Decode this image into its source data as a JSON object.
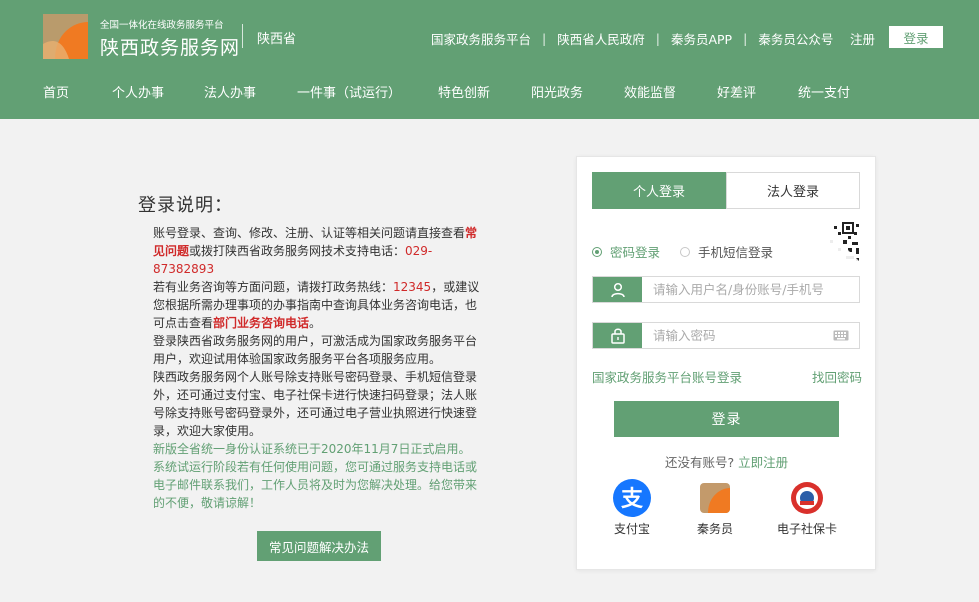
{
  "header": {
    "platform_tagline": "全国一体化在线政务服务平台",
    "site_name": "陕西政务服务网",
    "region": "陕西省",
    "links": [
      "国家政务服务平台",
      "陕西省人民政府",
      "秦务员APP",
      "秦务员公众号"
    ],
    "link_separator": "|",
    "register_label": "注册",
    "login_label": "登录",
    "colors": {
      "brand": "#62a074",
      "logo_orange": "#f07a22"
    }
  },
  "nav": [
    "首页",
    "个人办事",
    "法人办事",
    "一件事（试运行）",
    "特色创新",
    "阳光政务",
    "效能监督",
    "好差评",
    "统一支付"
  ],
  "instructions": {
    "title": "登录说明：",
    "p1_a": "账号登录、查询、修改、注册、认证等相关问题请直接查看",
    "p1_link": "常见问题",
    "p1_b": "或拨打陕西省政务服务网技术支持电话：",
    "p1_phone": "029-87382893",
    "p2_a": "若有业务咨询等方面问题，请拨打政务热线：",
    "p2_hotline": "12345",
    "p2_b": "，或建议您根据所需办理事项的办事指南中查询具体业务咨询电话，也可点击查看",
    "p2_link": "部门业务咨询电话",
    "p2_c": "。",
    "p3": "登录陕西省政务服务网的用户，可激活成为国家政务服务平台用户，欢迎试用体验国家政务服务平台各项服务应用。",
    "p4": "陕西政务服务网个人账号除支持账号密码登录、手机短信登录外，还可通过支付宝、电子社保卡进行快速扫码登录；法人账号除支持账号密码登录外，还可通过电子营业执照进行快速登录，欢迎大家使用。",
    "p5": "新版全省统一身份认证系统已于2020年11月7日正式启用。系统试运行阶段若有任何使用问题，您可通过服务支持电话或电子邮件联系我们，工作人员将及时为您解决处理。给您带来的不便，敬请谅解！",
    "faq_button": "常见问题解决办法"
  },
  "login": {
    "tabs": [
      "个人登录",
      "法人登录"
    ],
    "modes": [
      "密码登录",
      "手机短信登录"
    ],
    "selected_mode": "密码登录",
    "username_placeholder": "请输入用户名/身份账号/手机号",
    "password_placeholder": "请输入密码",
    "platform_link": "国家政务服务平台账号登录",
    "forgot_link": "找回密码",
    "submit": "登录",
    "no_account": "还没有账号?",
    "register_now": "立即注册",
    "alternatives": [
      {
        "label": "支付宝",
        "icon": "alipay-icon",
        "color": "#1677ff"
      },
      {
        "label": "秦务员",
        "icon": "qinwuyuan-icon",
        "color": "#f07a22"
      },
      {
        "label": "电子社保卡",
        "icon": "social-security-card-icon",
        "color": "#d9302b"
      }
    ]
  }
}
